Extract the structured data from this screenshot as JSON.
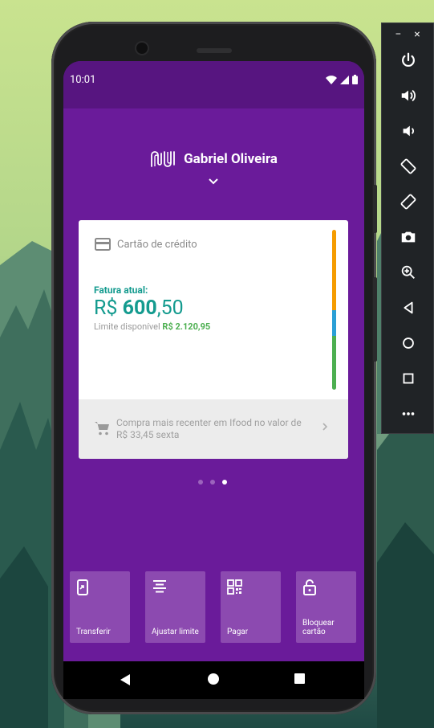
{
  "statusbar": {
    "time": "10:01"
  },
  "header": {
    "user_name": "Gabriel Oliveira",
    "logo_icon": "nubank-logo",
    "expand_icon": "chevron-down-icon"
  },
  "card": {
    "title": "Cartão de crédito",
    "invoice_label": "Fatura atual:",
    "invoice_currency": "R$ ",
    "invoice_integer": "600",
    "invoice_cents": ",50",
    "limit_label": "Limite disponível ",
    "limit_value": "R$ 2.120,95",
    "recent_purchase": "Compra mais recenter em Ifood no valor de R$ 33,45 sexta",
    "accent": "#149b8f"
  },
  "pager": {
    "count": 3,
    "active": 3
  },
  "actions": [
    {
      "label": "Transferir",
      "icon": "transfer-phone-icon"
    },
    {
      "label": "Ajustar limite",
      "icon": "adjust-limit-icon"
    },
    {
      "label": "Pagar",
      "icon": "qr-code-icon"
    },
    {
      "label": "Bloquear cartão",
      "icon": "lock-icon"
    }
  ],
  "colors": {
    "app_background": "#6a1b9a",
    "statusbar": "#571580",
    "action_tile": "#8c4ab0",
    "bar_orange": "#f59c00",
    "bar_blue": "#2a9fd6",
    "bar_green": "#4caf50"
  },
  "emulator_toolbar": {
    "minimize": "−",
    "close": "×",
    "buttons": [
      "power-icon",
      "volume-up-icon",
      "volume-down-icon",
      "rotate-left-icon",
      "rotate-right-icon",
      "camera-icon",
      "zoom-icon",
      "back-icon",
      "home-icon",
      "overview-icon",
      "more-icon"
    ]
  }
}
